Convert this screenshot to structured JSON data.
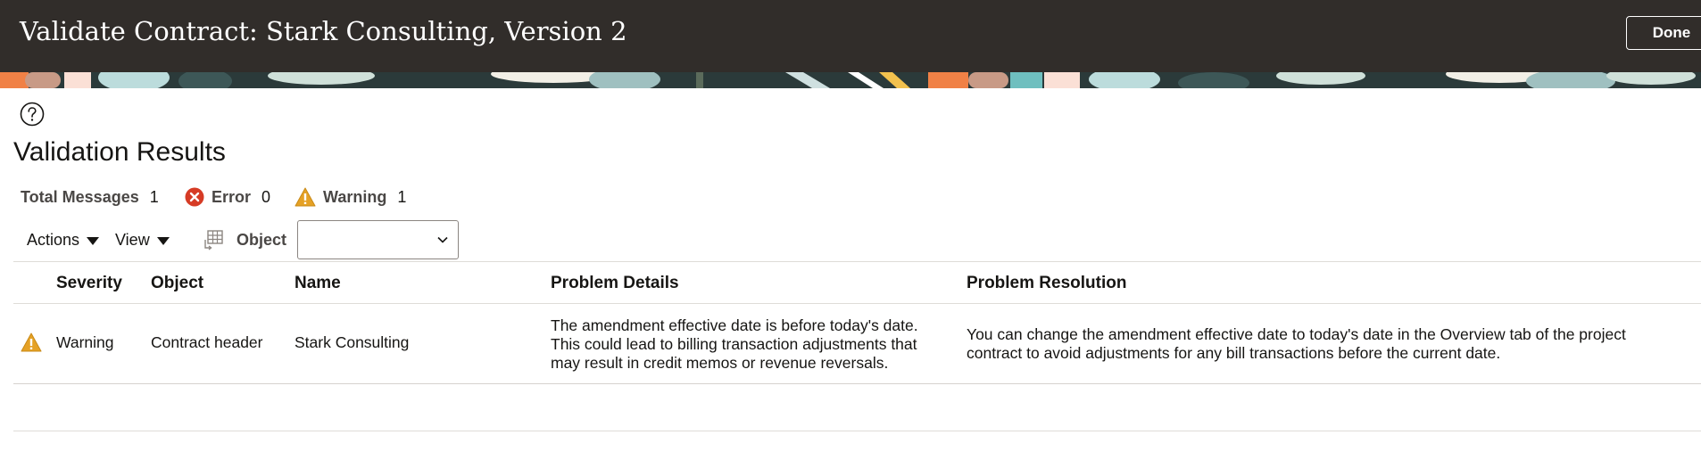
{
  "header": {
    "title": "Validate Contract: Stark Consulting, Version 2",
    "done_label": "Done"
  },
  "page": {
    "title": "Validation Results",
    "help_icon": "help-circle-icon"
  },
  "summary": {
    "total_label": "Total Messages",
    "total_value": "1",
    "error_label": "Error",
    "error_value": "0",
    "warning_label": "Warning",
    "warning_value": "1"
  },
  "toolbar": {
    "actions_label": "Actions",
    "view_label": "View",
    "object_label": "Object",
    "object_value": "",
    "object_icon": "table-export-icon"
  },
  "table": {
    "columns": [
      "Severity",
      "Object",
      "Name",
      "Problem Details",
      "Problem Resolution"
    ],
    "rows": [
      {
        "severity_icon": "warning-icon",
        "severity": "Warning",
        "object": "Contract header",
        "name": "Stark Consulting",
        "details": "The amendment effective date is before today's date. This could lead to billing transaction adjustments that may result in credit memos or revenue reversals.",
        "resolution": "You can change the amendment effective date to today's date in the Overview tab of the project contract to avoid adjustments for any bill transactions before the current date."
      }
    ]
  },
  "colors": {
    "header_bg": "#312d2a",
    "error": "#d63b25",
    "warning": "#e5a125"
  }
}
